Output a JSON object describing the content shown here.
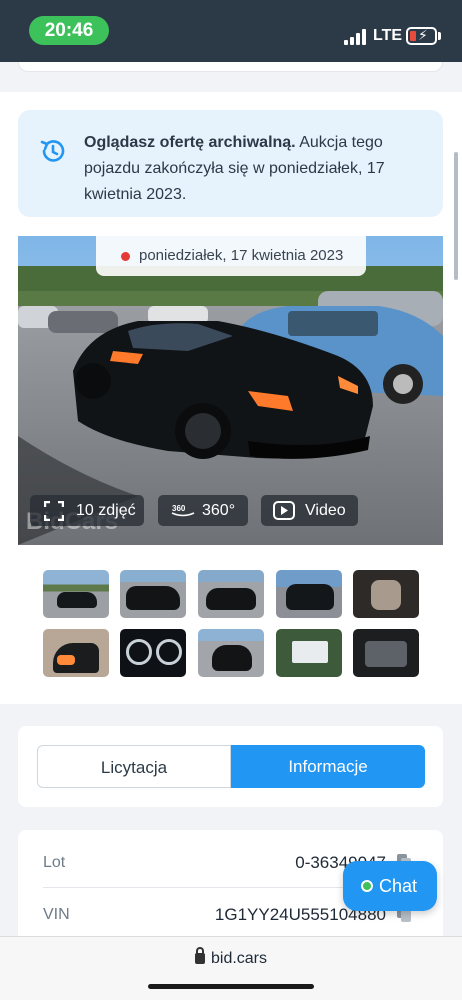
{
  "status_bar": {
    "time": "20:46",
    "network": "LTE"
  },
  "notice": {
    "bold": "Oglądasz ofertę archiwalną.",
    "text": " Aukcja tego pojazdu zakończyła się w poniedziałek, 17 kwietnia 2023."
  },
  "photo": {
    "date": "poniedziałek, 17 kwietnia 2023",
    "watermark": "BidCars",
    "buttons": {
      "photos": "10 zdjęć",
      "pano": "360°",
      "video": "Video"
    },
    "pano_icon_text": "360"
  },
  "tabs": {
    "left": "Licytacja",
    "right": "Informacje",
    "active": "right"
  },
  "info": {
    "rows": [
      {
        "label": "Lot",
        "value": "0-36349047"
      },
      {
        "label": "VIN",
        "value": "1G1YY24U555104880"
      }
    ]
  },
  "chat": {
    "label": "Chat"
  },
  "browser": {
    "url": "bid.cars"
  },
  "colors": {
    "accent": "#2196f3",
    "status_bg": "#2c3a48",
    "time_pill": "#3cc15b",
    "notice_bg": "#e6f3fd"
  }
}
